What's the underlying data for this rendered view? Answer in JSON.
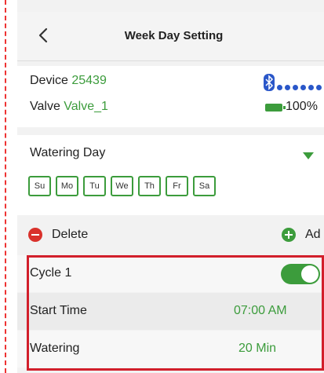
{
  "header": {
    "title": "Week Day Setting",
    "back_icon": "chevron-left-icon"
  },
  "device": {
    "device_label": "Device",
    "device_id": "25439",
    "valve_label": "Valve",
    "valve_name": "Valve_1",
    "signal_icon": "bluetooth-icon",
    "signal_bars": 5,
    "battery_icon": "battery-icon",
    "battery_percent": "100%"
  },
  "watering_day": {
    "title": "Watering Day",
    "days": [
      "Su",
      "Mo",
      "Tu",
      "We",
      "Th",
      "Fr",
      "Sa"
    ]
  },
  "actions": {
    "delete_label": "Delete",
    "add_label": "Ad"
  },
  "cycle": {
    "name": "Cycle 1",
    "enabled": true,
    "start_time_label": "Start Time",
    "start_time_value": "07:00 AM",
    "watering_label": "Watering",
    "watering_value": "20 Min"
  },
  "colors": {
    "accent": "#3c9c3c",
    "delete": "#d9312b",
    "highlight": "#d21f2b",
    "signal": "#2a57c9"
  }
}
